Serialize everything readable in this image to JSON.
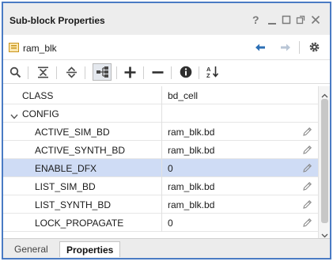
{
  "window": {
    "title": "Sub-block Properties",
    "controls": [
      "question-icon",
      "minimize-icon",
      "maximize-icon",
      "float-icon",
      "close-icon"
    ]
  },
  "object": {
    "name": "ram_blk",
    "icon": "block-design-icon"
  },
  "toolbar": {
    "icons": [
      "search-icon",
      "collapse-all-icon",
      "expand-all-icon",
      "group-by-category-icon",
      "add-icon",
      "remove-icon",
      "info-icon",
      "sort-alpha-icon"
    ]
  },
  "properties": {
    "rows": [
      {
        "name": "CLASS",
        "value": "bd_cell",
        "level": 0,
        "editable": false
      },
      {
        "name": "CONFIG",
        "value": "",
        "level": 0,
        "group": true,
        "expanded": true,
        "editable": false
      },
      {
        "name": "ACTIVE_SIM_BD",
        "value": "ram_blk.bd",
        "level": 1,
        "editable": true
      },
      {
        "name": "ACTIVE_SYNTH_BD",
        "value": "ram_blk.bd",
        "level": 1,
        "editable": true
      },
      {
        "name": "ENABLE_DFX",
        "value": "0",
        "level": 1,
        "editable": true,
        "selected": true
      },
      {
        "name": "LIST_SIM_BD",
        "value": "ram_blk.bd",
        "level": 1,
        "editable": true
      },
      {
        "name": "LIST_SYNTH_BD",
        "value": "ram_blk.bd",
        "level": 1,
        "editable": true
      },
      {
        "name": "LOCK_PROPAGATE",
        "value": "0",
        "level": 1,
        "editable": true
      }
    ]
  },
  "tabs": [
    {
      "label": "General",
      "active": false
    },
    {
      "label": "Properties",
      "active": true
    }
  ],
  "colors": {
    "border": "#4a7bc4",
    "selected_row": "#cfdcf5",
    "icon_blue": "#2c6fb5",
    "icon_gray": "#4a4a4a"
  }
}
